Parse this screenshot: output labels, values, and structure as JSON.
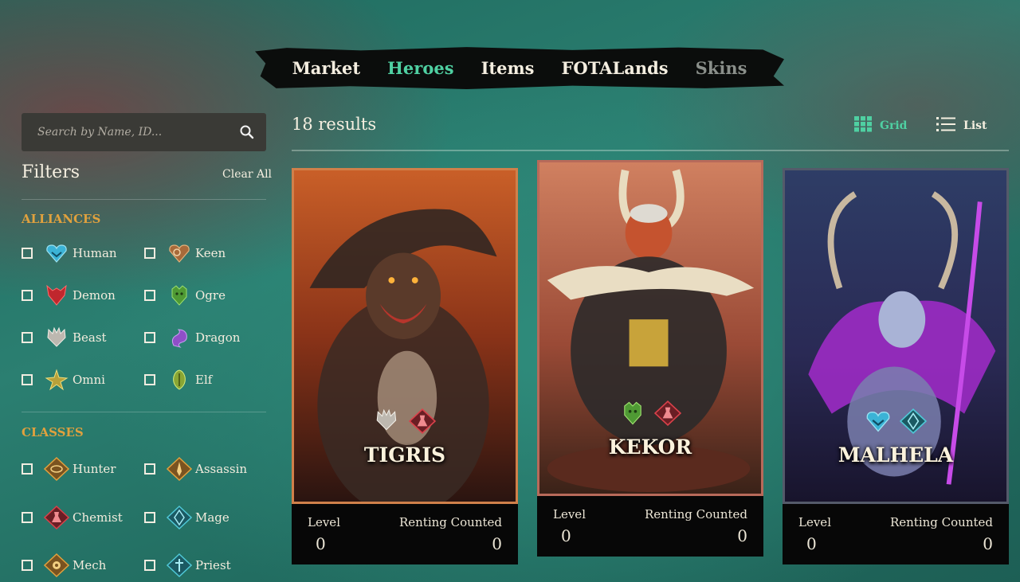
{
  "nav": {
    "items": [
      {
        "label": "Market",
        "state": "normal"
      },
      {
        "label": "Heroes",
        "state": "active"
      },
      {
        "label": "Items",
        "state": "normal"
      },
      {
        "label": "FOTALands",
        "state": "normal"
      },
      {
        "label": "Skins",
        "state": "disabled"
      }
    ]
  },
  "search": {
    "placeholder": "Search by Name, ID..."
  },
  "filters": {
    "title": "Filters",
    "clear_label": "Clear All",
    "alliances": {
      "title": "ALLIANCES",
      "options": [
        {
          "label": "Human",
          "icon": "human-icon",
          "color": "#3bb3d6"
        },
        {
          "label": "Keen",
          "icon": "keen-icon",
          "color": "#c98a4e"
        },
        {
          "label": "Demon",
          "icon": "demon-icon",
          "color": "#c0272d"
        },
        {
          "label": "Ogre",
          "icon": "ogre-icon",
          "color": "#5aa83a"
        },
        {
          "label": "Beast",
          "icon": "beast-icon",
          "color": "#c9c4bc"
        },
        {
          "label": "Dragon",
          "icon": "dragon-icon",
          "color": "#8f4fc8"
        },
        {
          "label": "Omni",
          "icon": "omni-icon",
          "color": "#c9b23a"
        },
        {
          "label": "Elf",
          "icon": "elf-icon",
          "color": "#9cb83a"
        }
      ]
    },
    "classes": {
      "title": "CLASSES",
      "options": [
        {
          "label": "Hunter",
          "icon": "hunter-icon",
          "color": "#e0a13e"
        },
        {
          "label": "Assassin",
          "icon": "assassin-icon",
          "color": "#e0a13e"
        },
        {
          "label": "Chemist",
          "icon": "chemist-icon",
          "color": "#d9414a"
        },
        {
          "label": "Mage",
          "icon": "mage-icon",
          "color": "#4fc7d6"
        },
        {
          "label": "Mech",
          "icon": "mech-icon",
          "color": "#e0a13e"
        },
        {
          "label": "Priest",
          "icon": "priest-icon",
          "color": "#4fc7d6"
        }
      ]
    }
  },
  "results": {
    "count_label": "18 results"
  },
  "view": {
    "grid_label": "Grid",
    "list_label": "List",
    "active": "grid"
  },
  "cards": [
    {
      "name": "TIGRIS",
      "level_label": "Level",
      "level": "0",
      "renting_label": "Renting Counted",
      "renting": "0",
      "border": "#d0804a",
      "bg_top": "#c7622a",
      "bg_bottom": "#3a1a10",
      "badges": [
        "beast-icon",
        "chemist-icon"
      ]
    },
    {
      "name": "KEKOR",
      "level_label": "Level",
      "level": "0",
      "renting_label": "Renting Counted",
      "renting": "0",
      "border": "#b86a5a",
      "bg_top": "#c7704a",
      "bg_bottom": "#3a2218",
      "badges": [
        "ogre-icon",
        "chemist-icon"
      ]
    },
    {
      "name": "MALHELA",
      "level_label": "Level",
      "level": "0",
      "renting_label": "Renting Counted",
      "renting": "0",
      "border": "#545a6a",
      "bg_top": "#2c3a64",
      "bg_bottom": "#1a1630",
      "badges": [
        "human-icon",
        "mage-icon"
      ]
    }
  ]
}
